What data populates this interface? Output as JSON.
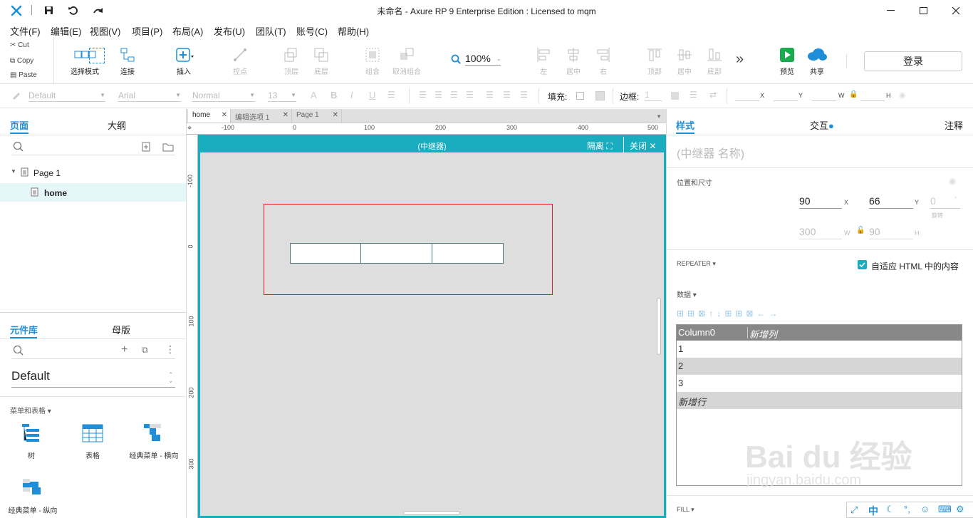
{
  "titlebar": {
    "title": "未命名 - Axure RP 9 Enterprise Edition : Licensed to mqm"
  },
  "menu": [
    "文件(F)",
    "编辑(E)",
    "视图(V)",
    "项目(P)",
    "布局(A)",
    "发布(U)",
    "团队(T)",
    "账号(C)",
    "帮助(H)"
  ],
  "clipboard": {
    "cut": "Cut",
    "copy": "Copy",
    "paste": "Paste"
  },
  "toolbar": {
    "select_mode": "选择模式",
    "connect": "连接",
    "insert": "插入",
    "points": "控点",
    "top": "顶层",
    "bottom": "底层",
    "group": "组合",
    "ungroup": "取消组合",
    "zoom": "100%",
    "align_left": "左",
    "align_center": "居中",
    "align_right": "右",
    "align_top": "顶部",
    "align_middle": "居中",
    "align_bottom": "底部",
    "more": "»",
    "preview": "预览",
    "share": "共享",
    "login": "登录"
  },
  "stylebar": {
    "style": "Default",
    "font": "Arial",
    "weight": "Normal",
    "size": "13",
    "fill_label": "填充:",
    "border_label": "边框:",
    "border_value": "1",
    "x_label": "X",
    "y_label": "Y",
    "w_label": "W",
    "h_label": "H"
  },
  "left": {
    "tabs": {
      "pages": "页面",
      "outline": "大纲"
    },
    "pages": [
      {
        "label": "Page 1"
      },
      {
        "label": "home"
      }
    ],
    "lib_tabs": {
      "library": "元件库",
      "masters": "母版"
    },
    "library_name": "Default",
    "category": "菜单和表格 ▾",
    "widgets": [
      "树",
      "表格",
      "经典菜单 - 横向",
      "经典菜单 - 纵向"
    ]
  },
  "center": {
    "tabs": [
      "home",
      "编辑选项 1",
      "Page 1"
    ],
    "ruler_h": [
      "-100",
      "0",
      "100",
      "200",
      "300",
      "400",
      "500"
    ],
    "ruler_v": [
      "-100",
      "0",
      "100",
      "200",
      "300"
    ],
    "context_title": "(中继器)",
    "isolate": "隔离",
    "close": "关闭"
  },
  "right": {
    "tabs": {
      "style": "样式",
      "interaction": "交互",
      "notes": "注释"
    },
    "name_placeholder": "(中继器 名称)",
    "pos_size_label": "位置和尺寸",
    "x": "90",
    "y": "66",
    "rotation": "0",
    "rotation_label": "旋转",
    "w": "300",
    "h": "90",
    "repeater_label": "REPEATER ▾",
    "fit_html": "自适应 HTML 中的内容",
    "data_label": "数据 ▾",
    "table": {
      "headers": [
        "Column0",
        "新增列"
      ],
      "rows": [
        "1",
        "2",
        "3"
      ],
      "new_row": "新增行"
    },
    "fill_label": "FILL ▾",
    "watermark": "Bai du 经验",
    "watermark_url": "jingyan.baidu.com",
    "ime": [
      "中"
    ]
  },
  "colors": {
    "accent": "#1aacbf",
    "blue": "#1e8ed9",
    "green": "#1aab4f",
    "red": "#e02020"
  }
}
